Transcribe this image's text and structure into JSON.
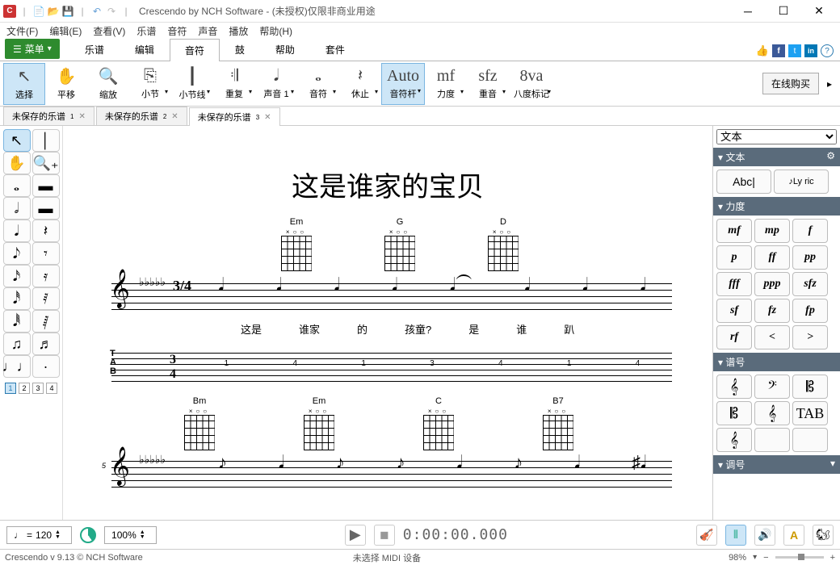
{
  "title": "Crescendo by NCH Software - (未授权)仅限非商业用途",
  "menus": [
    "文件(F)",
    "编辑(E)",
    "查看(V)",
    "乐谱",
    "音符",
    "声音",
    "播放",
    "帮助(H)"
  ],
  "menu_btn": "菜单",
  "ribbon_tabs": [
    "乐谱",
    "编辑",
    "音符",
    "鼓",
    "帮助",
    "套件"
  ],
  "ribbon_active": 2,
  "ribbon_buttons": [
    {
      "label": "选择",
      "icon": "↖",
      "sel": true,
      "dd": false
    },
    {
      "label": "平移",
      "icon": "✋",
      "dd": false
    },
    {
      "label": "缩放",
      "icon": "🔍",
      "dd": false
    },
    {
      "label": "小节",
      "icon": "⎘",
      "dd": true
    },
    {
      "label": "小节线",
      "icon": "┃",
      "dd": true
    },
    {
      "label": "重复",
      "icon": "𝄇",
      "dd": true
    },
    {
      "label": "声音 1",
      "icon": "𝅘𝅥",
      "dd": true
    },
    {
      "label": "音符",
      "icon": "𝅝",
      "dd": true
    },
    {
      "label": "休止",
      "icon": "𝄽",
      "dd": true
    },
    {
      "label": "音符杆",
      "icon": "Auto",
      "sel": true,
      "dd": true
    },
    {
      "label": "力度",
      "icon": "mf",
      "dd": true
    },
    {
      "label": "重音",
      "icon": "sfz",
      "dd": true
    },
    {
      "label": "八度标记",
      "icon": "8va",
      "dd": true
    }
  ],
  "buy_online": "在线购买",
  "doc_tabs": [
    {
      "label": "未保存的乐谱",
      "sup": "1"
    },
    {
      "label": "未保存的乐谱",
      "sup": "2"
    },
    {
      "label": "未保存的乐谱",
      "sup": "3",
      "active": true
    }
  ],
  "left_tools": [
    [
      "↖",
      "│"
    ],
    [
      "✋",
      "🔍₊"
    ],
    [
      "𝅝",
      "▬"
    ],
    [
      "𝅗𝅥",
      "▬"
    ],
    [
      "𝅘𝅥",
      "𝄽"
    ],
    [
      "𝅘𝅥𝅮",
      "𝄾"
    ],
    [
      "𝅘𝅥𝅯",
      "𝄿"
    ],
    [
      "𝅘𝅥𝅰",
      "𝅀"
    ],
    [
      "𝅘𝅥𝅱",
      "𝅁"
    ],
    [
      "♫",
      "♬"
    ],
    [
      "♩♩",
      "·"
    ]
  ],
  "voices": [
    "1",
    "2",
    "3",
    "4"
  ],
  "score": {
    "title": "这是谁家的宝贝",
    "chords1": [
      "Em",
      "G",
      "D"
    ],
    "lyrics": [
      "这是",
      "谁家",
      "的",
      "孩童?",
      "是",
      "谁",
      "趴"
    ],
    "time_sig": "3/4",
    "tab_nums": [
      "1",
      "4",
      "1",
      "3",
      "4",
      "1",
      "4"
    ],
    "chords2": [
      "Bm",
      "Em",
      "C",
      "B7"
    ],
    "measure5": "5"
  },
  "rpanel": {
    "selector": "文本",
    "sections": {
      "text": {
        "title": "文本",
        "items": [
          "Abc|",
          "Ly ric"
        ]
      },
      "dynamics": {
        "title": "力度",
        "items": [
          "mf",
          "mp",
          "f",
          "p",
          "ff",
          "pp",
          "fff",
          "ppp",
          "sfz",
          "sf",
          "fz",
          "fp",
          "rf",
          "<",
          ">"
        ]
      },
      "clef": {
        "title": "谱号",
        "items": [
          "𝄞",
          "𝄢",
          "𝄡",
          "𝄡",
          "𝄞",
          "TAB",
          "𝄞",
          " ",
          " "
        ]
      },
      "key": {
        "title": "调号"
      }
    }
  },
  "transport": {
    "tempo_note": "♩",
    "tempo_eq": "=",
    "tempo": "120",
    "zoom": "100%",
    "time": "0:00:00.000"
  },
  "status": {
    "left": "Crescendo v 9.13 © NCH Software",
    "mid": "未选择 MIDI 设备",
    "zoom": "98%"
  }
}
